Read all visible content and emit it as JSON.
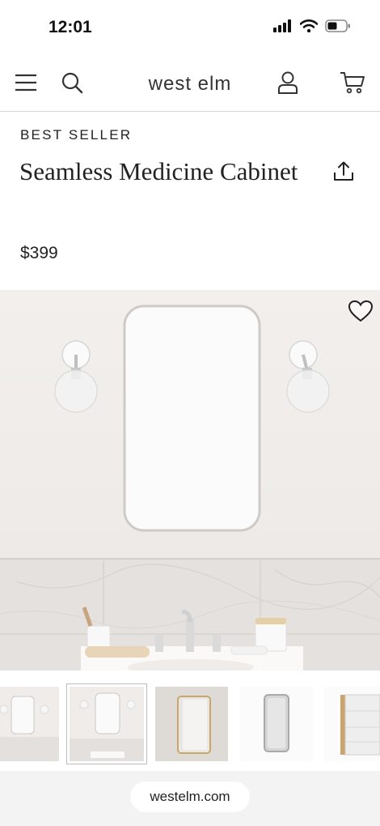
{
  "status": {
    "time": "12:01"
  },
  "nav": {
    "brand": "west elm"
  },
  "product": {
    "badge": "BEST SELLER",
    "title": "Seamless Medicine Cabinet",
    "price": "$399"
  },
  "thumbnails": {
    "count": 5,
    "active_index": 1
  },
  "browser": {
    "url": "westelm.com"
  }
}
